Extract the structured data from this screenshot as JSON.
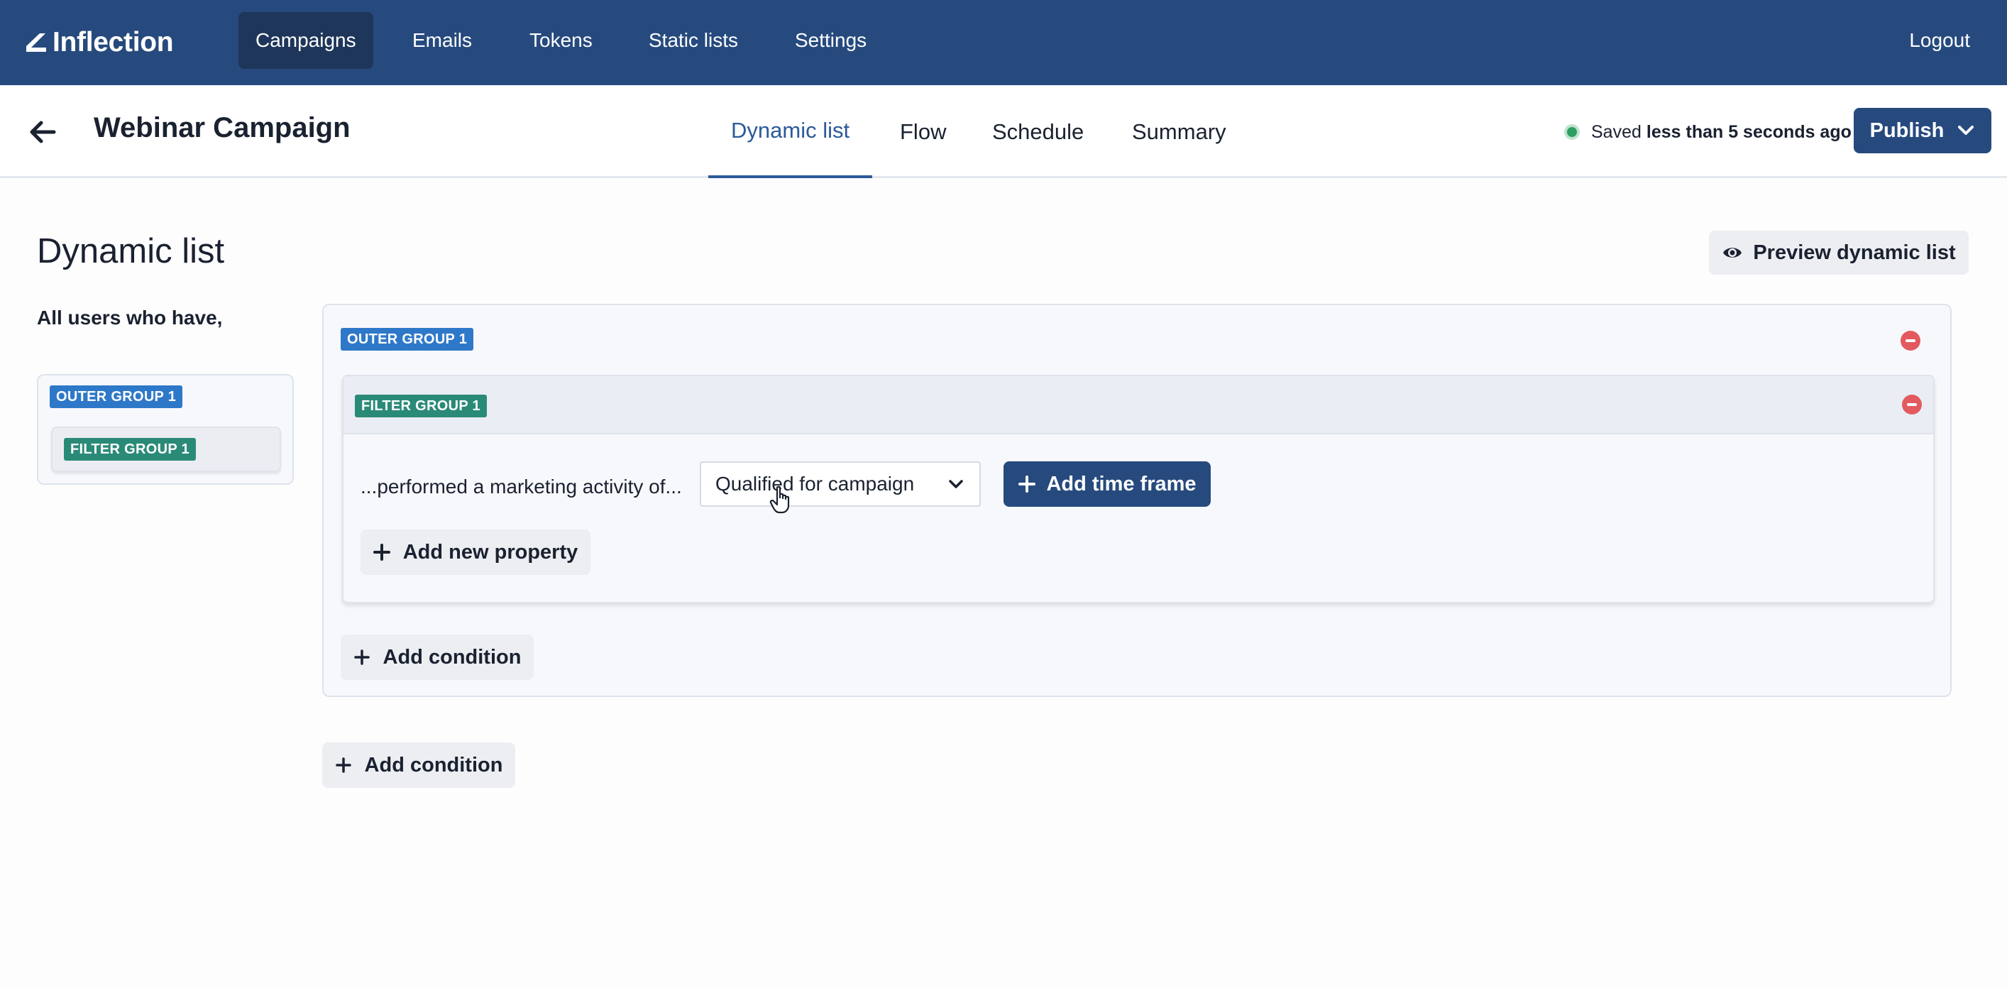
{
  "nav": {
    "brand": "Inflection",
    "items": [
      {
        "label": "Campaigns",
        "active": true
      },
      {
        "label": "Emails"
      },
      {
        "label": "Tokens"
      },
      {
        "label": "Static lists"
      },
      {
        "label": "Settings"
      }
    ],
    "logout": "Logout"
  },
  "header": {
    "campaign_title": "Webinar Campaign",
    "tabs": [
      {
        "label": "Dynamic list",
        "active": true
      },
      {
        "label": "Flow"
      },
      {
        "label": "Schedule"
      },
      {
        "label": "Summary"
      }
    ],
    "saved_prefix": "Saved",
    "saved_time": "less than 5 seconds ago",
    "publish_label": "Publish"
  },
  "page": {
    "title": "Dynamic list",
    "preview_label": "Preview dynamic list",
    "all_users_label": "All users who have,"
  },
  "overview": {
    "outer_group_badge": "OUTER GROUP 1",
    "filter_group_badge": "FILTER GROUP 1"
  },
  "outer_group": {
    "badge": "OUTER GROUP 1",
    "filter_group": {
      "badge": "FILTER GROUP 1",
      "condition_text": "...performed a marketing activity of...",
      "activity_value": "Qualified for campaign",
      "add_time_frame_label": "Add time frame",
      "add_property_label": "Add new property"
    },
    "add_condition_label": "Add condition"
  },
  "root_add_condition_label": "Add condition",
  "colors": {
    "nav_bg": "#264a7e",
    "accent": "#2b5a98",
    "outer_badge": "#2e78c9",
    "filter_badge": "#2a8a78",
    "remove": "#e25a5f",
    "saved_dot": "#2f9e62"
  }
}
